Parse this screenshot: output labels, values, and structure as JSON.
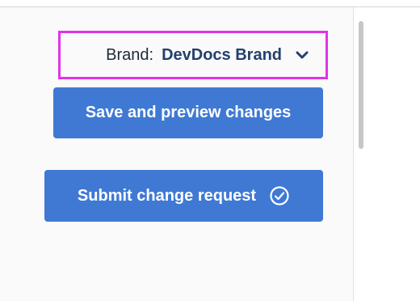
{
  "brand_selector": {
    "label": "Brand:",
    "value": "DevDocs Brand",
    "icon": "chevron-down-icon",
    "highlight_color": "#e233e6"
  },
  "buttons": {
    "save_label": "Save and preview changes",
    "submit_label": "Submit change request",
    "submit_icon": "check-circle-icon",
    "color": "#3f79d4"
  }
}
